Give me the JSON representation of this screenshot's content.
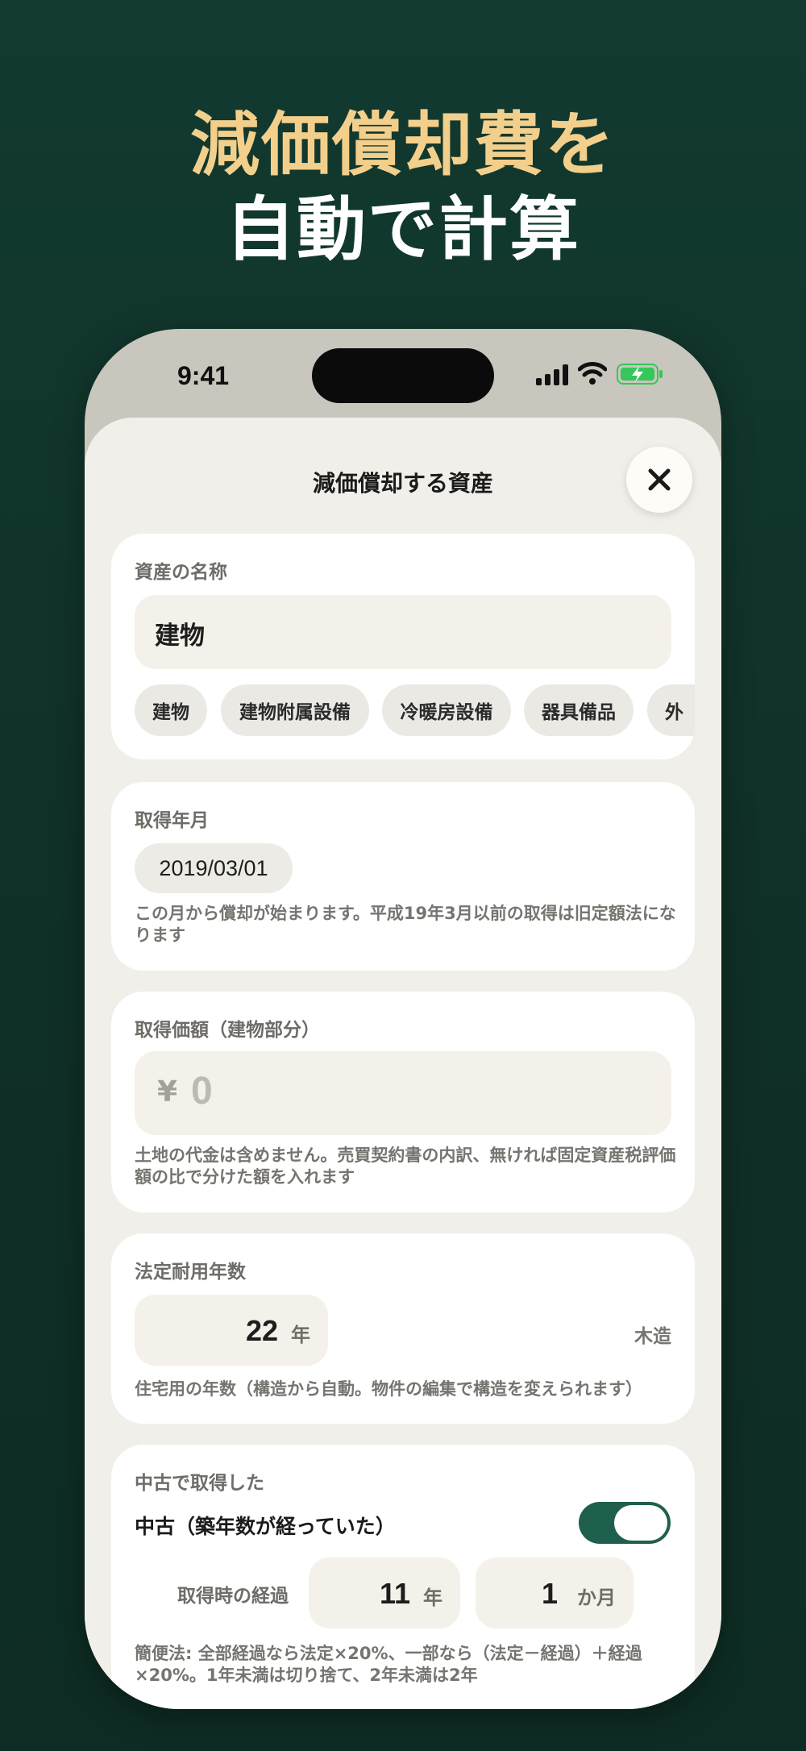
{
  "headline": {
    "line1": "減価償却費を",
    "line2": "自動で計算"
  },
  "status": {
    "time": "9:41"
  },
  "sheet": {
    "title": "減価償却する資産"
  },
  "asset_name": {
    "label": "資産の名称",
    "value": "建物",
    "chips": [
      "建物",
      "建物附属設備",
      "冷暖房設備",
      "器具備品",
      "外"
    ]
  },
  "acquisition_date": {
    "label": "取得年月",
    "value": "2019/03/01",
    "note": "この月から償却が始まります。平成19年3月以前の取得は旧定額法になります"
  },
  "acquisition_price": {
    "label": "取得価額（建物部分）",
    "currency": "¥",
    "placeholder": "0",
    "note": "土地の代金は含めません。売買契約書の内訳、無ければ固定資産税評価額の比で分けた額を入れます"
  },
  "useful_life": {
    "label": "法定耐用年数",
    "value": "22",
    "unit": "年",
    "structure": "木造",
    "note": "住宅用の年数（構造から自動。物件の編集で構造を変えられます）"
  },
  "used_asset": {
    "label": "中古で取得した",
    "toggle_label": "中古（築年数が経っていた）",
    "toggle_on": true,
    "elapsed_label": "取得時の経過",
    "years": "11",
    "years_unit": "年",
    "months": "1",
    "months_unit": "か月",
    "note": "簡便法: 全部経過なら法定×20%、一部なら（法定－経過）＋経過×20%。1年未満は切り捨て、2年未満は2年"
  },
  "colors": {
    "background": "#123a30",
    "accent_gold": "#f3cf8c",
    "toggle_on": "#1f5f4d",
    "battery": "#34c759"
  }
}
